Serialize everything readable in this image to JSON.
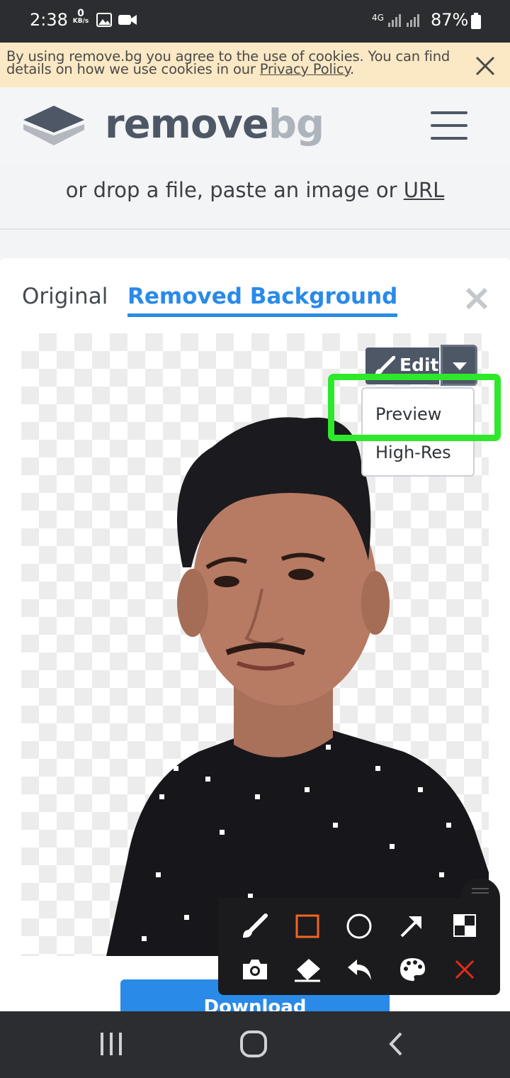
{
  "status_bar": {
    "time": "2:38",
    "net_speed_value": "0",
    "net_speed_unit": "KB/s",
    "network": "4G",
    "battery": "87%"
  },
  "cookie_banner": {
    "text_before": "By using remove.bg you agree to the use of cookies. You can find details on how we use cookies in our ",
    "link": "Privacy Policy",
    "text_after": ".",
    "close_icon": "close-icon"
  },
  "header": {
    "logo_word1": "remove",
    "logo_word2": "bg",
    "menu_icon": "hamburger-menu-icon"
  },
  "drop_area": {
    "text": "or drop a file, paste an image or ",
    "link": "URL"
  },
  "tabs": [
    {
      "label": "Original",
      "active": false
    },
    {
      "label": "Removed Background",
      "active": true
    }
  ],
  "edit": {
    "label": "Edit",
    "icon": "brush-icon",
    "dropdown_icon": "caret-down-icon",
    "options": [
      "Preview",
      "High-Res"
    ]
  },
  "download": {
    "label": "Download"
  },
  "toolbar": {
    "row1": [
      "brush-icon",
      "rectangle-icon",
      "circle-icon",
      "arrow-icon",
      "mosaic-icon"
    ],
    "row2": [
      "camera-icon",
      "eraser-icon",
      "undo-icon",
      "palette-icon",
      "close-icon"
    ]
  },
  "colors": {
    "accent": "#2a8ae8",
    "highlight": "#2ee82b",
    "cookie_bg": "#fbe8c4",
    "logo_dark": "#4d5766",
    "logo_light": "#aeb4bc"
  }
}
